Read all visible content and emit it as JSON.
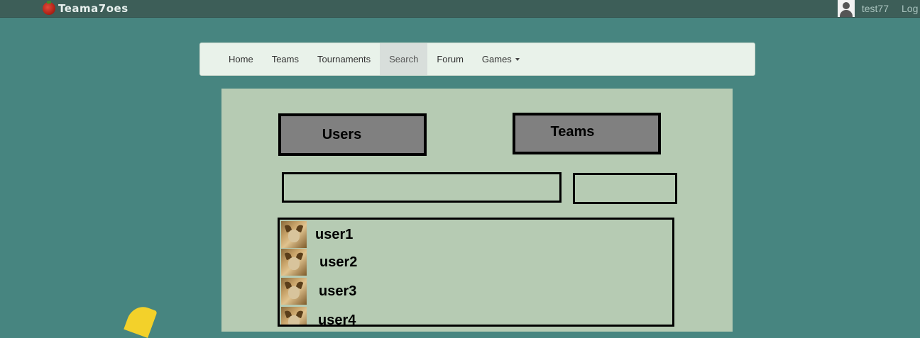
{
  "topbar": {
    "logo_text": "Teama7oes",
    "username": "test77",
    "logout_label": "Log"
  },
  "nav": {
    "items": [
      {
        "label": "Home"
      },
      {
        "label": "Teams"
      },
      {
        "label": "Tournaments"
      },
      {
        "label": "Search",
        "active": true
      },
      {
        "label": "Forum"
      },
      {
        "label": "Games",
        "dropdown": true
      }
    ]
  },
  "search": {
    "users_tab_label": "Users",
    "teams_tab_label": "Teams",
    "query_value": "",
    "results": [
      {
        "name": "user1"
      },
      {
        "name": "user2"
      },
      {
        "name": "user3"
      },
      {
        "name": "user4"
      }
    ]
  },
  "colors": {
    "background": "#478580",
    "topbar": "#3d5e58",
    "panel": "#b6cbb3",
    "tab_fill": "#808080",
    "logo_accent": "#b22418"
  },
  "icons": {
    "logo": "tomato-icon",
    "avatar": "default-avatar-icon",
    "dropdown": "caret-down-icon",
    "result_thumb": "user-photo-icon"
  }
}
